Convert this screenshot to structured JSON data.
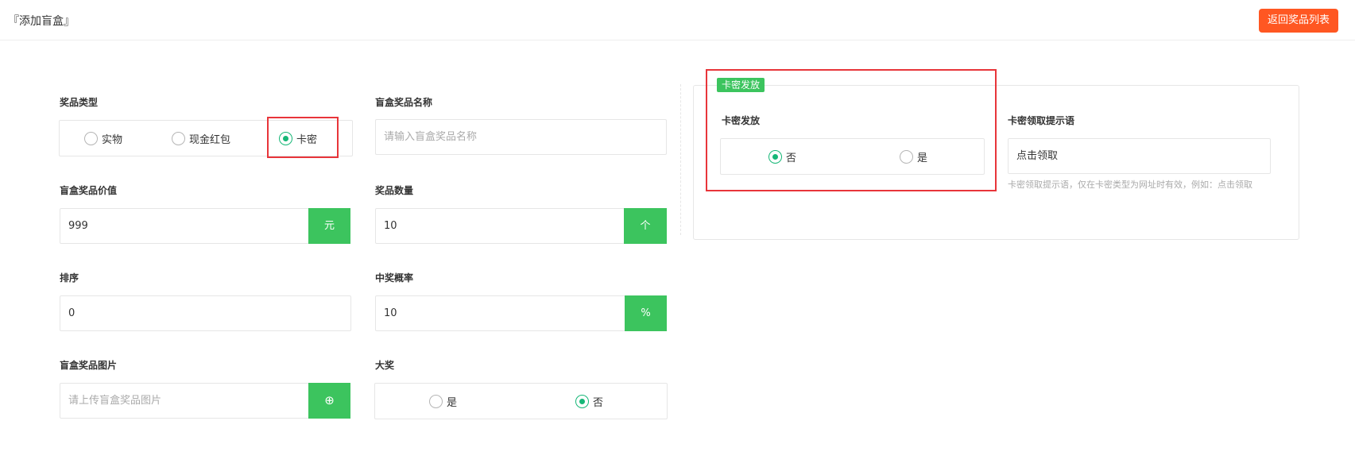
{
  "header": {
    "title": "『添加盲盒』",
    "return_button": "返回奖品列表"
  },
  "form": {
    "prize_type": {
      "label": "奖品类型",
      "options": [
        "实物",
        "现金红包",
        "卡密"
      ],
      "selected": "卡密"
    },
    "prize_name": {
      "label": "盲盒奖品名称",
      "placeholder": "请输入盲盒奖品名称"
    },
    "prize_value": {
      "label": "盲盒奖品价值",
      "value": "999",
      "unit": "元"
    },
    "quantity": {
      "label": "奖品数量",
      "value": "10",
      "unit": "个"
    },
    "sort": {
      "label": "排序",
      "value": "0"
    },
    "probability": {
      "label": "中奖概率",
      "value": "10",
      "unit": "%"
    },
    "image": {
      "label": "盲盒奖品图片",
      "placeholder": "请上传盲盒奖品图片",
      "upload_icon": "plus-circle-icon",
      "upload_glyph": "⊕"
    },
    "grand_prize": {
      "label": "大奖",
      "options": [
        "是",
        "否"
      ],
      "selected": "否"
    }
  },
  "card_section": {
    "legend": "卡密发放",
    "issue": {
      "label": "卡密发放",
      "options": [
        "否",
        "是"
      ],
      "selected": "否"
    },
    "prompt": {
      "label": "卡密领取提示语",
      "value": "点击领取",
      "hint": "卡密领取提示语，仅在卡密类型为网址时有效，例如：点击领取"
    }
  },
  "colors": {
    "accent_green": "#3cc45e",
    "radio_green": "#16b777",
    "orange_button": "#ff5722",
    "highlight_red": "#e8353a"
  }
}
